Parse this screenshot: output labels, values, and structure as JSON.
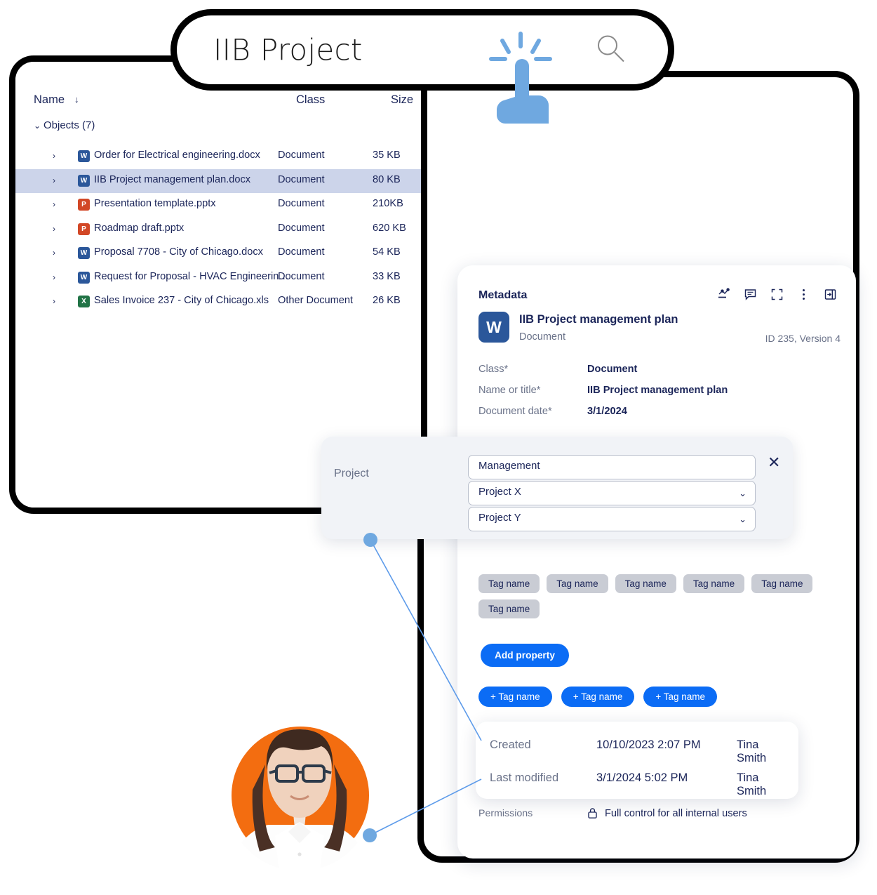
{
  "search": {
    "query": "IIB Project",
    "search_icon": "magnifier-icon",
    "cursor_icon": "tap-hand-icon"
  },
  "file_list": {
    "columns": {
      "name": "Name",
      "class": "Class",
      "size": "Size"
    },
    "sort_indicator": "↓",
    "group": {
      "label": "Objects (7)",
      "expanded": true,
      "chevron": "⌄"
    },
    "rows": [
      {
        "name": "Order for Electrical engineering.docx",
        "class": "Document",
        "size": "35 KB",
        "icon": "word-file-icon",
        "icon_letter": "W",
        "icon_type": "word",
        "selected": false
      },
      {
        "name": "IIB Project management plan.docx",
        "class": "Document",
        "size": "80 KB",
        "icon": "word-file-icon",
        "icon_letter": "W",
        "icon_type": "word",
        "selected": true
      },
      {
        "name": "Presentation template.pptx",
        "class": "Document",
        "size": "210KB",
        "icon": "powerpoint-file-icon",
        "icon_letter": "P",
        "icon_type": "ppt",
        "selected": false
      },
      {
        "name": "Roadmap draft.pptx",
        "class": "Document",
        "size": "620 KB",
        "icon": "powerpoint-file-icon",
        "icon_letter": "P",
        "icon_type": "ppt",
        "selected": false
      },
      {
        "name": "Proposal 7708 - City of Chicago.docx",
        "class": "Document",
        "size": "54 KB",
        "icon": "word-file-icon",
        "icon_letter": "W",
        "icon_type": "word",
        "selected": false
      },
      {
        "name": "Request for Proposal - HVAC Engineerin…",
        "class": "Document",
        "size": "33 KB",
        "icon": "word-file-icon",
        "icon_letter": "W",
        "icon_type": "word",
        "selected": false
      },
      {
        "name": "Sales Invoice 237 - City of Chicago.xls",
        "class": "Other Document",
        "size": "26 KB",
        "icon": "excel-file-icon",
        "icon_letter": "X",
        "icon_type": "xls",
        "selected": false
      }
    ]
  },
  "metadata": {
    "panel_title": "Metadata",
    "toolbar": [
      {
        "name": "workflow-icon"
      },
      {
        "name": "comment-icon"
      },
      {
        "name": "fullscreen-icon"
      },
      {
        "name": "more-options-icon"
      },
      {
        "name": "collapse-panel-icon"
      }
    ],
    "document": {
      "icon_letter": "W",
      "title": "IIB Project management plan",
      "class_label": "Document",
      "version_info": "ID 235, Version 4"
    },
    "fields": [
      {
        "label": "Class*",
        "value": "Document"
      },
      {
        "label": "Name or title*",
        "value": "IIB Project management plan"
      },
      {
        "label": "Document date*",
        "value": "3/1/2024"
      }
    ],
    "tags": [
      "Tag name",
      "Tag name",
      "Tag name",
      "Tag name",
      "Tag name",
      "Tag name"
    ],
    "add_property_label": "Add property",
    "tag_buttons": [
      "+ Tag name",
      "+ Tag name",
      "+ Tag name"
    ],
    "permissions": {
      "label": "Permissions",
      "icon": "lock-icon",
      "value": "Full control for all internal users"
    }
  },
  "project_panel": {
    "label": "Project",
    "close_icon": "close-icon",
    "fields": [
      {
        "value": "Management",
        "type": "text",
        "has_chevron": false
      },
      {
        "value": "Project X",
        "type": "select",
        "has_chevron": true,
        "chevron": "⌄"
      },
      {
        "value": "Project Y",
        "type": "select",
        "has_chevron": true,
        "chevron": "⌄"
      }
    ]
  },
  "dates_card": {
    "rows": [
      {
        "label": "Created",
        "value": "10/10/2023 2:07 PM",
        "user": "Tina Smith"
      },
      {
        "label": "Last modified",
        "value": "3/1/2024 5:02 PM",
        "user": "Tina Smith"
      }
    ]
  },
  "avatar": {
    "name": "user-avatar",
    "background_color": "#f36d10"
  },
  "colors": {
    "accent_blue": "#0b6cf5",
    "selection": "#ccd4ea",
    "word": "#2b579a",
    "powerpoint": "#d24726",
    "excel": "#217346",
    "cloud": "#d5dfeb",
    "tag_gray": "#c9ccd4",
    "text_navy": "#1b2559",
    "text_muted": "#6a7289",
    "connector": "#5d9bea"
  }
}
